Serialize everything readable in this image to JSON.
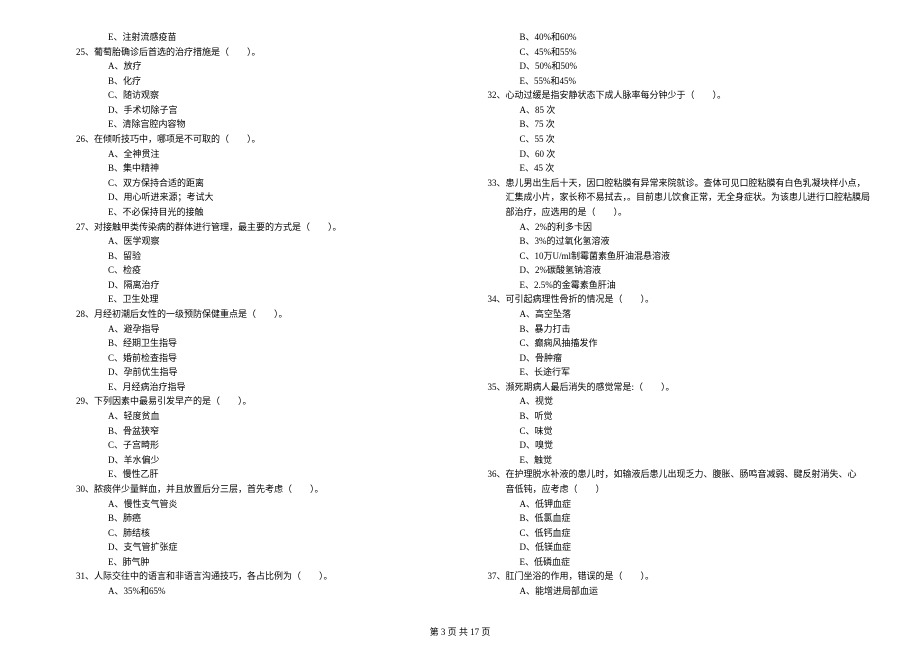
{
  "footer": "第 3 页 共 17 页",
  "left": {
    "pre_opt": "E、注射流感疫苗",
    "items": [
      {
        "num": "25、",
        "stem": "葡萄胎确诊后首选的治疗措施是（　　）。",
        "opts": [
          "A、放疗",
          "B、化疗",
          "C、随访观察",
          "D、手术切除子宫",
          "E、清除宫腔内容物"
        ]
      },
      {
        "num": "26、",
        "stem": "在倾听技巧中，哪项是不可取的（　　）。",
        "opts": [
          "A、全神贯注",
          "B、集中精神",
          "C、双方保持合适的距离",
          "D、用心听进来源；考试大",
          "E、不必保持目光的接触"
        ]
      },
      {
        "num": "27、",
        "stem": "对接触甲类传染病的群体进行管理，最主要的方式是（　　）。",
        "opts": [
          "A、医学观察",
          "B、留验",
          "C、检疫",
          "D、隔离治疗",
          "E、卫生处理"
        ]
      },
      {
        "num": "28、",
        "stem": "月经初潮后女性的一级预防保健重点是（　　）。",
        "opts": [
          "A、避孕指导",
          "B、经期卫生指导",
          "C、婚前检查指导",
          "D、孕前优生指导",
          "E、月经病治疗指导"
        ]
      },
      {
        "num": "29、",
        "stem": "下列因素中最易引发早产的是（　　）。",
        "opts": [
          "A、轻度贫血",
          "B、骨盆狭窄",
          "C、子宫畸形",
          "D、羊水偏少",
          "E、慢性乙肝"
        ]
      },
      {
        "num": "30、",
        "stem": "脓痰伴少量鲜血，并且放置后分三层，首先考虑（　　）。",
        "opts": [
          "A、慢性支气管炎",
          "B、肺癌",
          "C、肺结核",
          "D、支气管扩张症",
          "E、肺气肿"
        ]
      },
      {
        "num": "31、",
        "stem": "人际交往中的语言和非语言沟通技巧，各占比例为（　　）。",
        "opts": [
          "A、35%和65%"
        ]
      }
    ]
  },
  "right": {
    "pre_opts": [
      "B、40%和60%",
      "C、45%和55%",
      "D、50%和50%",
      "E、55%和45%"
    ],
    "items": [
      {
        "num": "32、",
        "stem": "心动过缓是指安静状态下成人脉率每分钟少于（　　）。",
        "opts": [
          "A、85 次",
          "B、75 次",
          "C、55 次",
          "D、60 次",
          "E、45 次"
        ]
      },
      {
        "num": "33、",
        "stem_lines": [
          "患儿男出生后十天，因口腔粘膜有异常来院就诊。查体可见口腔粘膜有白色乳凝块样小点，",
          "汇集成小片，家长称不易拭去，。目前患儿饮食正常，无全身症状。为该患儿进行口腔粘膜局",
          "部治疗，应选用的是（　　）。"
        ],
        "opts": [
          "A、2%的利多卡因",
          "B、3%的过氧化氢溶液",
          "C、10万U/ml制霉菌素鱼肝油混悬溶液",
          "D、2%碳酸氢钠溶液",
          "E、2.5%的金霉素鱼肝油"
        ]
      },
      {
        "num": "34、",
        "stem": "可引起病理性骨折的情况是（　　）。",
        "opts": [
          "A、高空坠落",
          "B、暴力打击",
          "C、癫痫风抽搐发作",
          "D、骨肿瘤",
          "E、长途行军"
        ]
      },
      {
        "num": "35、",
        "stem": "濒死期病人最后消失的感觉常是:（　　）。",
        "opts": [
          "A、视觉",
          "B、听觉",
          "C、味觉",
          "D、嗅觉",
          "E、触觉"
        ]
      },
      {
        "num": "36、",
        "stem_lines": [
          "在护理脱水补液的患儿时，如输液后患儿出现乏力、腹胀、肠鸣音减弱、腱反射消失、心",
          "音低钝，应考虑（　　）"
        ],
        "opts": [
          "A、低钾血症",
          "B、低氯血症",
          "C、低钙血症",
          "D、低镁血症",
          "E、低磷血症"
        ]
      },
      {
        "num": "37、",
        "stem": "肛门坐浴的作用，错误的是（　　）。",
        "opts": [
          "A、能增进局部血运"
        ]
      }
    ]
  }
}
